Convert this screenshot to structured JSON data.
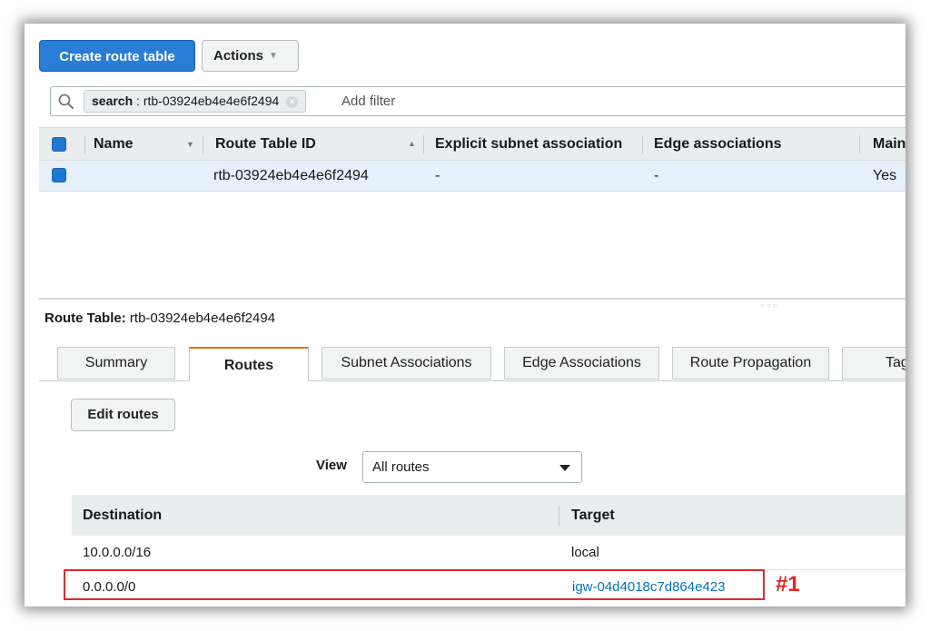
{
  "toolbar": {
    "create_label": "Create route table",
    "actions_label": "Actions"
  },
  "search": {
    "token_key": "search",
    "token_value": " : rtb-03924eb4e4e6f2494",
    "add_filter": "Add filter"
  },
  "table": {
    "columns": [
      "Name",
      "Route Table ID",
      "Explicit subnet association",
      "Edge associations",
      "Main"
    ],
    "row": {
      "name": "",
      "route_table_id": "rtb-03924eb4e4e6f2494",
      "explicit_subnet": "-",
      "edge": "-",
      "main": "Yes"
    }
  },
  "details": {
    "title_label": "Route Table:",
    "title_value": " rtb-03924eb4e4e6f2494",
    "tabs": [
      "Summary",
      "Routes",
      "Subnet Associations",
      "Edge Associations",
      "Route Propagation",
      "Tags"
    ],
    "active_tab": "Routes",
    "edit_routes_label": "Edit routes",
    "view_label": "View",
    "view_selected": "All routes",
    "routes_columns": [
      "Destination",
      "Target"
    ],
    "routes": [
      {
        "destination": "10.0.0.0/16",
        "target": "local"
      },
      {
        "destination": "0.0.0.0/0",
        "target": "igw-04d4018c7d864e423"
      }
    ]
  },
  "annotation": {
    "label": "#1",
    "color": "#e0282a"
  },
  "colors": {
    "primary": "#2a7dd5",
    "link": "#0073bb",
    "tab_accent": "#ec7211",
    "selected_row": "#e6f0fa"
  }
}
